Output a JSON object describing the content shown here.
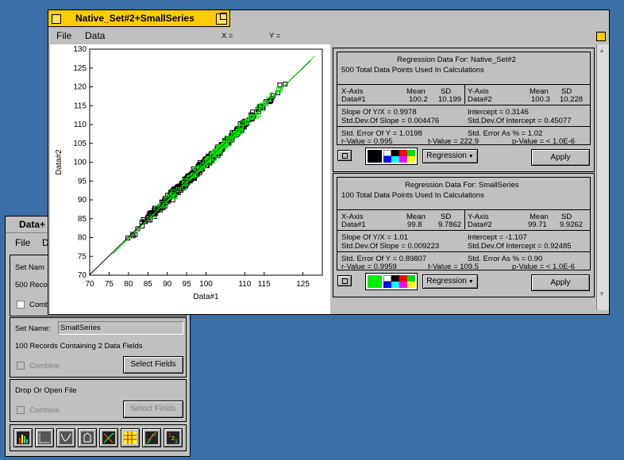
{
  "main_window": {
    "title": "Native_Set#2+SmallSeries",
    "menu": [
      "File",
      "Data"
    ],
    "coord_x_label": "X =",
    "coord_y_label": "Y ="
  },
  "chart_data": {
    "type": "scatter",
    "xlabel": "Data#1",
    "ylabel": "Data#2",
    "xlim": [
      70,
      130
    ],
    "ylim": [
      70,
      130
    ],
    "xticks": [
      "70",
      "75",
      "80",
      "85",
      "90",
      "95",
      "100",
      "110",
      "115",
      "125"
    ],
    "xtick_values": [
      70,
      75,
      80,
      85,
      90,
      95,
      100,
      110,
      115,
      125
    ],
    "yticks": [
      "70",
      "75",
      "80",
      "85",
      "90",
      "95",
      "100",
      "105",
      "110",
      "115",
      "120",
      "125",
      "130"
    ],
    "series": [
      {
        "color": "#000000",
        "n": 500,
        "slope": 0.9978,
        "intercept": 0.3146,
        "x_range": [
          72,
          126
        ]
      },
      {
        "color": "#00ee00",
        "n": 100,
        "slope": 1.01,
        "intercept": -1.107,
        "x_range": [
          78,
          127
        ]
      }
    ]
  },
  "panel1": {
    "title": "Regression Data For: Native_Set#2",
    "points": "500 Total Data Points Used In Calculations",
    "x_axis": "X-Axis",
    "x_name": "Data#1",
    "x_mean_h": "Mean",
    "x_mean": "100.2",
    "x_sd_h": "SD",
    "x_sd": "10.199",
    "y_axis": "Y-Axis",
    "y_name": "Data#2",
    "y_mean_h": "Mean",
    "y_mean": "100.3",
    "y_sd_h": "SD",
    "y_sd": "10.228",
    "slope": "Slope Of Y/X = 0.9978",
    "intercept": "Intercept = 0.3146",
    "sd_slope": "Std.Dev.Of Slope = 0.004476",
    "sd_intercept": "Std.Dev.Of Intercept = 0.45077",
    "se_y": "Std. Error Of Y = 1.0198",
    "se_pct": "Std. Error As % = 1.02",
    "r": "r-Value = 0.995",
    "t": "t-Value = 222.9",
    "p": "p-Value = < 1.0E-6",
    "regression_label": "Regression",
    "apply_label": "Apply",
    "accent": "#000000"
  },
  "panel2": {
    "title": "Regression Data For: SmallSeries",
    "points": "100 Total Data Points Used In Calculations",
    "x_axis": "X-Axis",
    "x_name": "Data#1",
    "x_mean_h": "Mean",
    "x_mean": "99.8",
    "x_sd_h": "SD",
    "x_sd": "9.7862",
    "y_axis": "Y-Axis",
    "y_name": "Data#2",
    "y_mean_h": "Mean",
    "y_mean": "99.71",
    "y_sd_h": "SD",
    "y_sd": "9.9262",
    "slope": "Slope Of Y/X = 1.01",
    "intercept": "Intercept = -1.107",
    "sd_slope": "Std.Dev.Of Slope = 0.009223",
    "sd_intercept": "Std.Dev.Of Intercept = 0.92485",
    "se_y": "Std. Error Of Y = 0.89807",
    "se_pct": "Std. Error As % = 0.90",
    "r": "r-Value = 0.9959",
    "t": "t-Value = 109.5",
    "p": "p-Value = < 1.0E-6",
    "regression_label": "Regression",
    "apply_label": "Apply",
    "accent": "#00ee00"
  },
  "data_window": {
    "title": "Data+",
    "menu": [
      "File",
      "D"
    ],
    "set1_label": "Set Nam",
    "set1_records": "500 Recor",
    "set1_combine": "Comb",
    "set2_label": "Set Name:",
    "set2_value": "SmallSeries",
    "set2_records": "100 Records Containing 2 Data Fields",
    "set2_combine": "Combine",
    "set2_select": "Select Fields",
    "drop_label": "Drop Or Open File",
    "drop_combine": "Combine",
    "drop_select": "Select Fields",
    "toolbar_icons": [
      "histogram-icon",
      "blank-plot-icon",
      "curve-plot-icon",
      "3d-plot-icon",
      "regression-icon",
      "table-grid-icon",
      "curve-fit-icon",
      "sequence-icon"
    ]
  }
}
